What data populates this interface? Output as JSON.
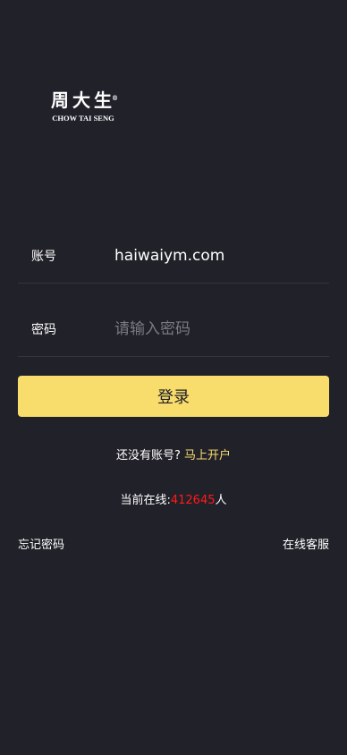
{
  "brand": {
    "logo_cn": "周大生",
    "logo_reg": "®",
    "logo_en": "CHOW TAI SENG"
  },
  "form": {
    "account_label": "账号",
    "account_value": "haiwaiym.com",
    "password_label": "密码",
    "password_placeholder": "请输入密码",
    "login_label": "登录"
  },
  "signup": {
    "prompt": "还没有账号?",
    "link": "马上开户"
  },
  "online": {
    "prefix": "当前在线:",
    "count": "412645",
    "suffix": "人"
  },
  "footer": {
    "forgot_password": "忘记密码",
    "customer_service": "在线客服"
  },
  "colors": {
    "background": "#21212a",
    "accent": "#f8dd6c",
    "count": "#ff1a1a"
  }
}
